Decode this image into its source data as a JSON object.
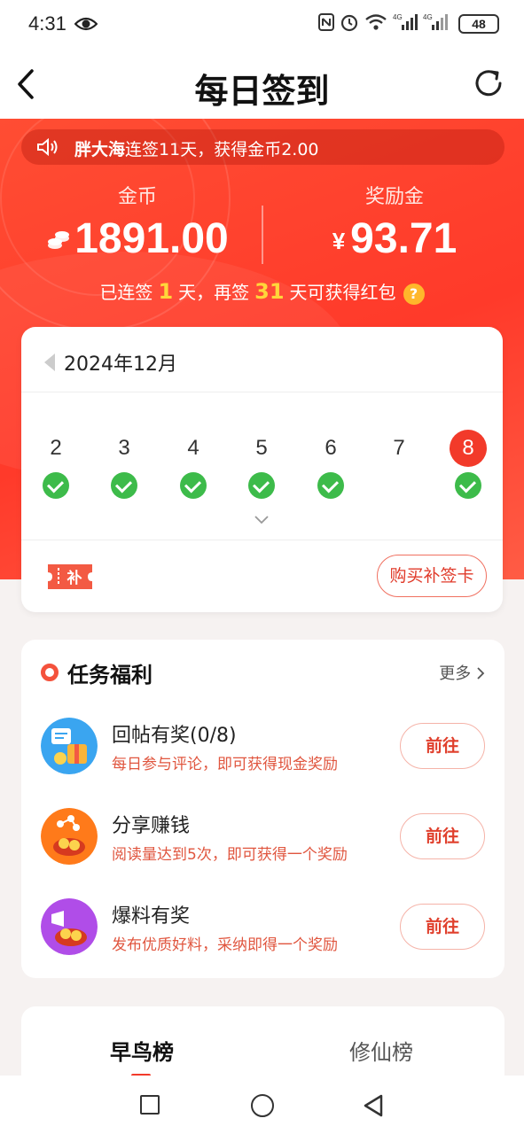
{
  "status_bar": {
    "time": "4:31",
    "battery": "48",
    "network": "4G"
  },
  "header": {
    "title": "每日签到"
  },
  "notice": {
    "user": "胖大海",
    "text": "连签11天，获得金币2.00"
  },
  "stats": {
    "coins_label": "金币",
    "coins_value": "1891.00",
    "reward_label": "奖励金",
    "reward_currency": "¥",
    "reward_value": "93.71"
  },
  "streak": {
    "prefix": "已连签",
    "days": "1",
    "middle": "天，再签",
    "remaining": "31",
    "suffix": "天可获得红包",
    "help": "?"
  },
  "calendar": {
    "month": "2024年12月",
    "days": [
      {
        "num": "2",
        "checked": true
      },
      {
        "num": "3",
        "checked": true
      },
      {
        "num": "4",
        "checked": true
      },
      {
        "num": "5",
        "checked": true
      },
      {
        "num": "6",
        "checked": true
      },
      {
        "num": "7",
        "checked": false
      },
      {
        "num": "8",
        "checked": true,
        "today": true
      }
    ],
    "buy_card_label": "购买补签卡",
    "ticket_text": "补"
  },
  "tasks": {
    "title": "任务福利",
    "more": "更多",
    "items": [
      {
        "name": "回帖有奖(0/8)",
        "desc": "每日参与评论，即可获得现金奖励",
        "button": "前往",
        "icon": "comment-reward-icon"
      },
      {
        "name": "分享赚钱",
        "desc": "阅读量达到5次，即可获得一个奖励",
        "button": "前往",
        "icon": "share-reward-icon"
      },
      {
        "name": "爆料有奖",
        "desc": "发布优质好料，采纳即得一个奖励",
        "button": "前往",
        "icon": "tipoff-reward-icon"
      }
    ]
  },
  "ranking": {
    "tabs": [
      "早鸟榜",
      "修仙榜"
    ]
  },
  "colors": {
    "brand_red": "#ff3a2a",
    "check_green": "#3dbb4a",
    "highlight_yellow": "#ffd63a"
  }
}
